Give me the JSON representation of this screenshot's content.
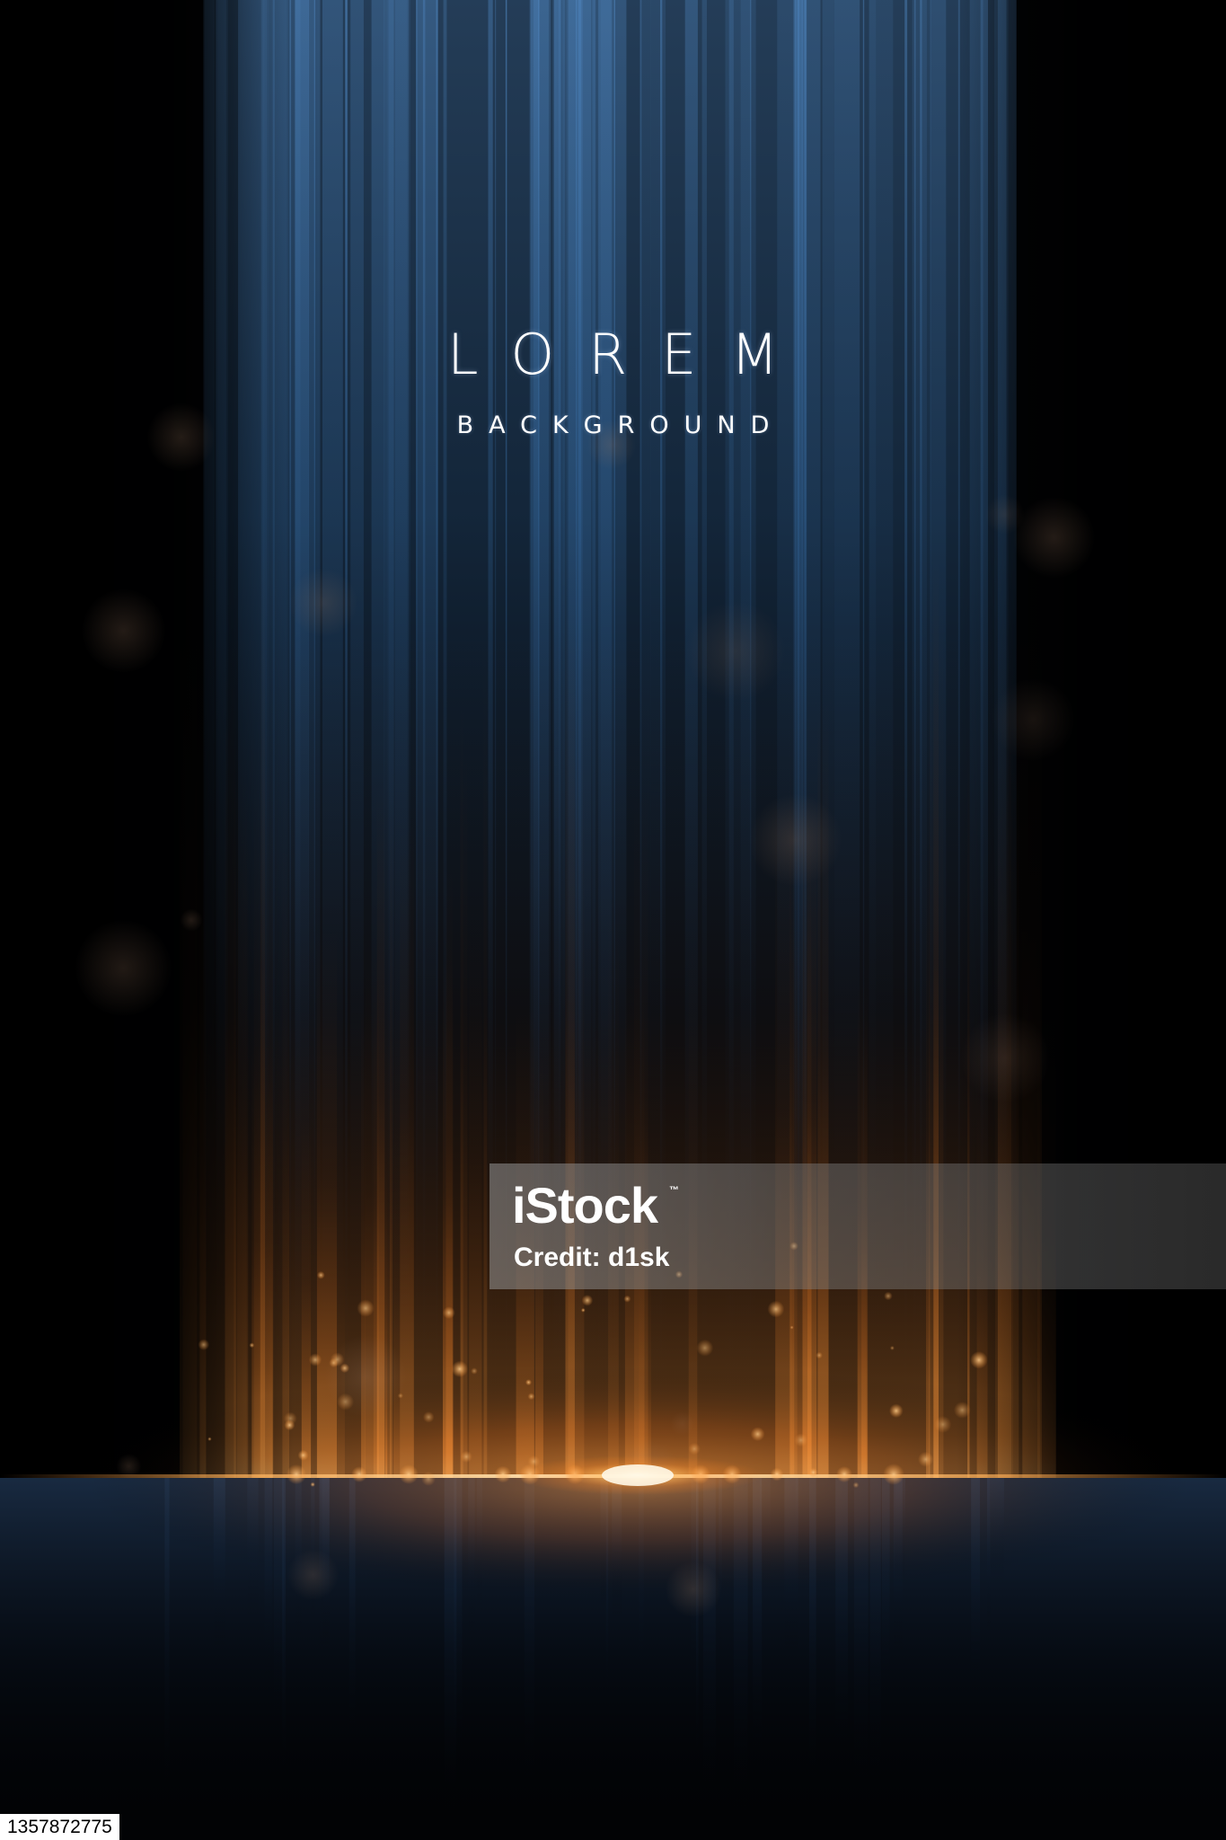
{
  "poster": {
    "title": "LOREM",
    "subtitle": "BACKGROUND"
  },
  "watermark": {
    "brand": "iStock",
    "trademark": "™",
    "credit": "Credit: d1sk"
  },
  "image_id": "1357872775",
  "colors": {
    "background": "#020305",
    "blue_light": "#5a8fc8",
    "gold_light": "#ff9a3c",
    "flare_core": "#fff3d6"
  }
}
